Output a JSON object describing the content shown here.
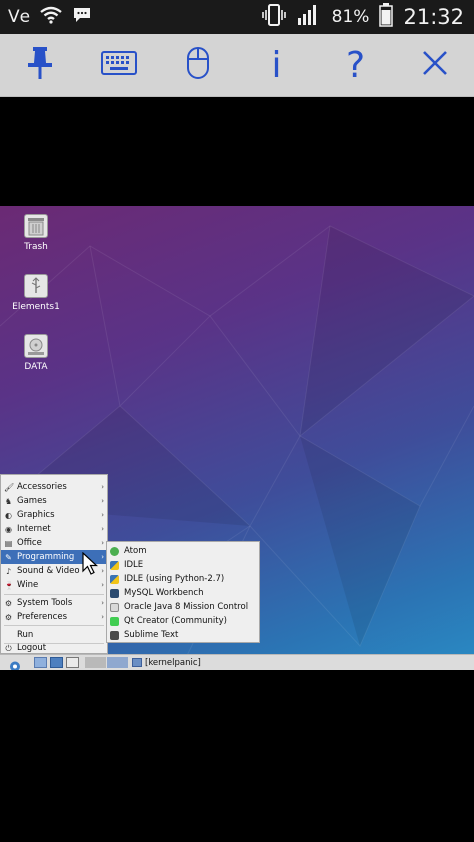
{
  "status_bar": {
    "carrier": "Vе",
    "battery_percent": "81%",
    "time": "21:32"
  },
  "toolbar": {
    "info_label": "i",
    "help_label": "?"
  },
  "desktop": {
    "icons": [
      {
        "label": "Trash"
      },
      {
        "label": "Elements1"
      },
      {
        "label": "DATA"
      }
    ]
  },
  "start_menu": {
    "items": [
      {
        "label": "Accessories"
      },
      {
        "label": "Games"
      },
      {
        "label": "Graphics"
      },
      {
        "label": "Internet"
      },
      {
        "label": "Office"
      },
      {
        "label": "Programming"
      },
      {
        "label": "Sound & Video"
      },
      {
        "label": "Wine"
      },
      {
        "label": "System Tools"
      },
      {
        "label": "Preferences"
      },
      {
        "label": "Run"
      },
      {
        "label": "Logout"
      }
    ],
    "submenu_arrow": "›"
  },
  "programming_submenu": {
    "items": [
      {
        "label": "Atom",
        "icon_color": "#4caf50"
      },
      {
        "label": "IDLE",
        "icon_color": "#f0c419"
      },
      {
        "label": "IDLE (using Python-2.7)",
        "icon_color": "#3a74b5"
      },
      {
        "label": "MySQL Workbench",
        "icon_color": "#2b4a6f"
      },
      {
        "label": "Oracle Java 8 Mission Control",
        "icon_color": "#8a8a8a"
      },
      {
        "label": "Qt Creator (Community)",
        "icon_color": "#41cd52"
      },
      {
        "label": "Sublime Text",
        "icon_color": "#4a4a4a"
      }
    ]
  },
  "taskbar": {
    "window_title": "[kernelpanic]"
  },
  "colors": {
    "accent": "#2851c8",
    "menu_highlight": "#3d6fb8"
  }
}
